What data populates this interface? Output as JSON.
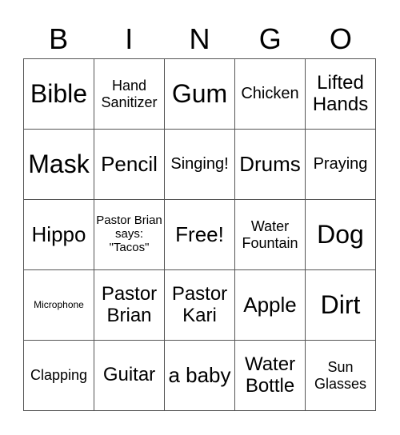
{
  "header": [
    "B",
    "I",
    "N",
    "G",
    "O"
  ],
  "cells": [
    {
      "text": "Bible",
      "size": "s36"
    },
    {
      "text": "Hand Sanitizer",
      "size": "s18"
    },
    {
      "text": "Gum",
      "size": "s36"
    },
    {
      "text": "Chicken",
      "size": "s20"
    },
    {
      "text": "Lifted Hands",
      "size": "s24"
    },
    {
      "text": "Mask",
      "size": "s36"
    },
    {
      "text": "Pencil",
      "size": "s28"
    },
    {
      "text": "Singing!",
      "size": "s20"
    },
    {
      "text": "Drums",
      "size": "s28"
    },
    {
      "text": "Praying",
      "size": "s20"
    },
    {
      "text": "Hippo",
      "size": "s28"
    },
    {
      "text": "Pastor Brian says: \"Tacos\"",
      "size": "s15"
    },
    {
      "text": "Free!",
      "size": "s28"
    },
    {
      "text": "Water Fountain",
      "size": "s18"
    },
    {
      "text": "Dog",
      "size": "s36"
    },
    {
      "text": "Microphone",
      "size": "s12"
    },
    {
      "text": "Pastor Brian",
      "size": "s24"
    },
    {
      "text": "Pastor Kari",
      "size": "s24"
    },
    {
      "text": "Apple",
      "size": "s28"
    },
    {
      "text": "Dirt",
      "size": "s36"
    },
    {
      "text": "Clapping",
      "size": "s18"
    },
    {
      "text": "Guitar",
      "size": "s24"
    },
    {
      "text": "a baby",
      "size": "s28"
    },
    {
      "text": "Water Bottle",
      "size": "s24"
    },
    {
      "text": "Sun Glasses",
      "size": "s18"
    }
  ]
}
